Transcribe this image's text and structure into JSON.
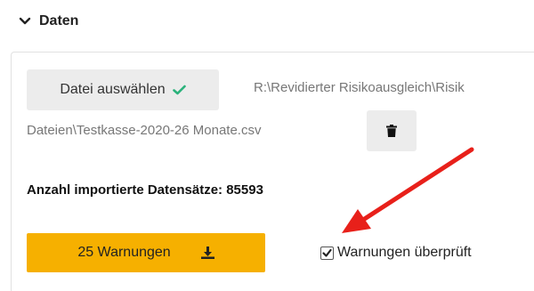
{
  "section": {
    "title": "Daten",
    "icon": "chevron-down-icon"
  },
  "file": {
    "button_label": "Datei auswählen",
    "check_icon": "checkmark-icon",
    "check_color": "#2ab27b",
    "path_line1": "R:\\Revidierter Risikoausgleich\\Risik",
    "path_line2": "Dateien\\Testkasse-2020-26 Monate.csv",
    "delete_icon": "trash-icon"
  },
  "import": {
    "count_text": "Anzahl importierte Datensätze: 85593"
  },
  "warnings": {
    "button_label": "25 Warnungen",
    "button_color": "#f6b000",
    "download_icon": "download-icon",
    "checkbox_label": "Warnungen überprüft",
    "checkbox_checked": true
  },
  "annotation": {
    "arrow_color": "#e8201a"
  }
}
